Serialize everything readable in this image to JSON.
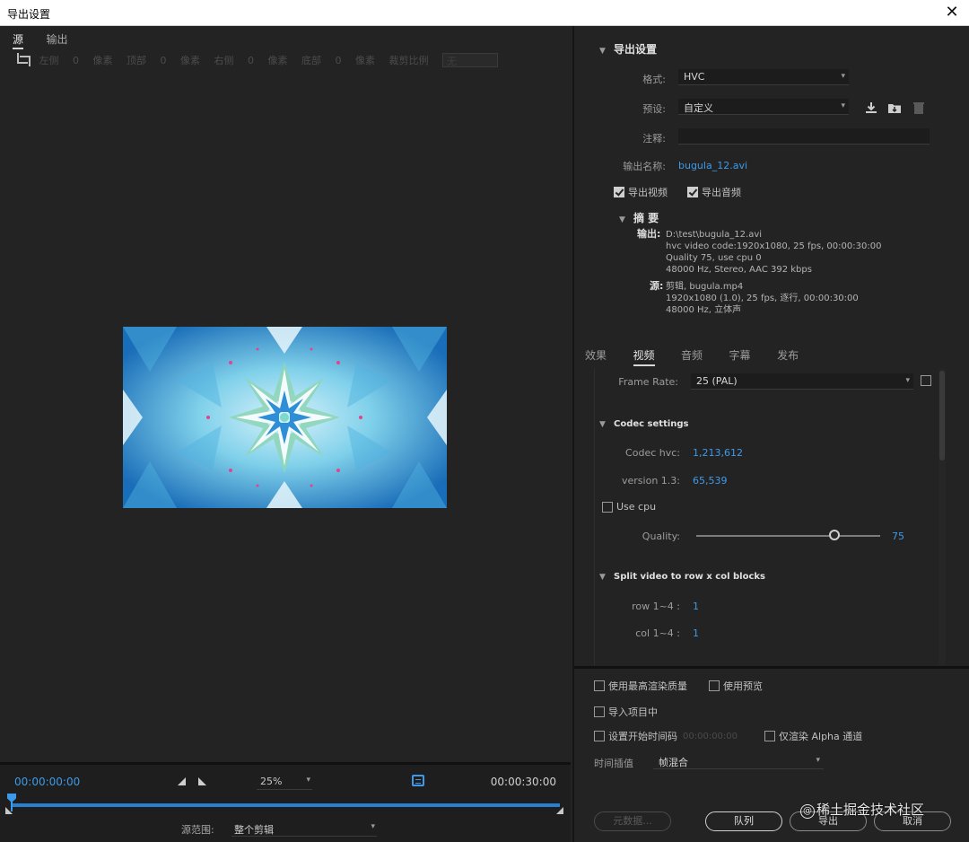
{
  "window": {
    "title": "导出设置",
    "close_glyph": "✕"
  },
  "left": {
    "tabs": [
      {
        "label": "源",
        "active": true
      },
      {
        "label": "输出",
        "active": false
      }
    ],
    "crop": {
      "left_label": "左侧",
      "left_val": "0",
      "px1": "像素",
      "top_label": "顶部",
      "top_val": "0",
      "px2": "像素",
      "right_label": "右侧",
      "right_val": "0",
      "px3": "像素",
      "bottom_label": "底部",
      "bottom_val": "0",
      "px4": "像素",
      "ratio_label": "裁剪比例",
      "ratio_val": "无"
    },
    "timeline": {
      "current": "00:00:00:00",
      "end": "00:00:30:00",
      "zoom": "25%",
      "range_label": "源范围:",
      "range_value": "整个剪辑"
    }
  },
  "export": {
    "section_title": "导出设置",
    "format_label": "格式:",
    "format_value": "HVC",
    "preset_label": "预设:",
    "preset_value": "自定义",
    "comment_label": "注释:",
    "comment_value": "",
    "output_name_label": "输出名称:",
    "output_name_value": "bugula_12.avi",
    "export_video_label": "导出视频",
    "export_video_checked": true,
    "export_audio_label": "导出音频",
    "export_audio_checked": true
  },
  "summary": {
    "title": "摘 要",
    "output_key": "输出:",
    "output_lines": [
      "D:\\test\\bugula_12.avi",
      "hvc video code:1920x1080, 25 fps,  00:00:30:00",
      "Quality 75, use cpu 0",
      "48000 Hz, Stereo, AAC 392 kbps"
    ],
    "source_key": "源:",
    "source_lines": [
      "剪辑, bugula.mp4",
      "1920x1080 (1.0),  25 fps, 逐行,  00:00:30:00",
      "48000 Hz, 立体声"
    ]
  },
  "settings_tabs": [
    {
      "label": "效果",
      "active": false
    },
    {
      "label": "视频",
      "active": true
    },
    {
      "label": "音频",
      "active": false
    },
    {
      "label": "字幕",
      "active": false
    },
    {
      "label": "发布",
      "active": false
    }
  ],
  "video": {
    "frame_rate_label": "Frame Rate:",
    "frame_rate_value": "25 (PAL)",
    "codec_section": "Codec settings",
    "codec_label": "Codec hvc:",
    "codec_value": "1,213,612",
    "version_label": "version 1.3:",
    "version_value": "65,539",
    "use_cpu_label": "Use cpu",
    "use_cpu_checked": false,
    "quality_label": "Quality:",
    "quality_value": "75",
    "quality_fraction": 0.75,
    "split_section": "Split video to row x col blocks",
    "row_label": "row 1~4 :",
    "row_value": "1",
    "col_label": "col 1~4 :",
    "col_value": "1"
  },
  "bottom": {
    "max_render_label": "使用最高渲染质量",
    "max_render_checked": false,
    "use_preview_label": "使用预览",
    "use_preview_checked": false,
    "import_label": "导入项目中",
    "import_checked": false,
    "start_tc_label": "设置开始时间码",
    "start_tc_value": "00:00:00:00",
    "start_tc_checked": false,
    "alpha_label": "仅渲染 Alpha 通道",
    "alpha_checked": false,
    "interp_label": "时间插值",
    "interp_value": "帧混合",
    "metadata_btn": "元数据...",
    "queue_btn": "队列",
    "export_btn": "导出",
    "cancel_btn": "取消"
  },
  "watermark": {
    "badge": "@",
    "text": "稀土掘金技术社区"
  }
}
